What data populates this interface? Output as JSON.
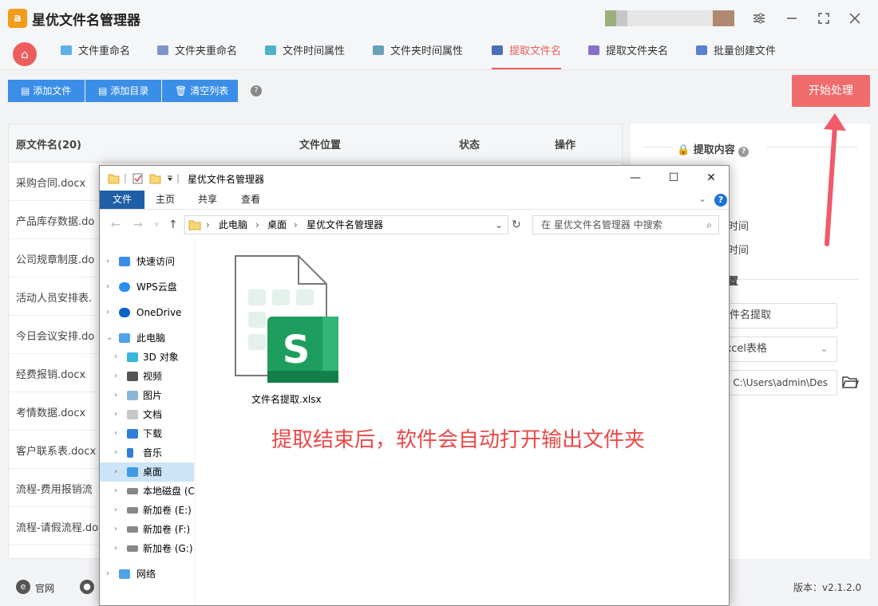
{
  "app": {
    "logo_glyph": "a",
    "title": "星优文件名管理器",
    "window_controls": [
      "settings-icon",
      "minimize-icon",
      "maximize-icon",
      "close-icon"
    ]
  },
  "nav": {
    "home_icon": "home-icon",
    "tabs": [
      {
        "label": "文件重命名",
        "active": false
      },
      {
        "label": "文件夹重命名",
        "active": false
      },
      {
        "label": "文件时间属性",
        "active": false
      },
      {
        "label": "文件夹时间属性",
        "active": false
      },
      {
        "label": "提取文件名",
        "active": true
      },
      {
        "label": "提取文件夹名",
        "active": false
      },
      {
        "label": "批量创建文件",
        "active": false
      }
    ]
  },
  "toolbar": {
    "add_file": "添加文件",
    "add_folder": "添加目录",
    "clear_list": "清空列表",
    "help": "?",
    "start": "开始处理"
  },
  "table": {
    "headers": {
      "name": "原文件名(20)",
      "location": "文件位置",
      "status": "状态",
      "action": "操作"
    },
    "rows": [
      "采购合同.docx",
      "产品库存数据.do",
      "公司规章制度.do",
      "活动人员安排表.",
      "今日会议安排.do",
      "经费报销.docx",
      "考情数据.docx",
      "客户联系表.docx",
      "流程-费用报销流",
      "流程-请假流程.do"
    ]
  },
  "right_panel": {
    "section_title": "提取内容",
    "partial_time_1": "时间",
    "partial_time_2": "时间",
    "partial_heading": "置",
    "mode_value": "文件名提取",
    "format_value": "excel表格",
    "output_path": "C:\\Users\\admin\\Des"
  },
  "footer": {
    "official_site": "官网",
    "version": "版本：v2.1.2.0"
  },
  "explorer": {
    "title": "星优文件名管理器",
    "ribbon_tabs": [
      {
        "label": "文件",
        "active": true
      },
      {
        "label": "主页",
        "active": false
      },
      {
        "label": "共享",
        "active": false
      },
      {
        "label": "查看",
        "active": false
      }
    ],
    "address": [
      "此电脑",
      "桌面",
      "星优文件名管理器"
    ],
    "search_placeholder": "在 星优文件名管理器 中搜索",
    "nav_items": [
      {
        "label": "快速访问",
        "icon": "star-icon",
        "indent": 0
      },
      {
        "label": "WPS云盘",
        "icon": "cloud-icon",
        "indent": 0
      },
      {
        "label": "OneDrive",
        "icon": "onedrive-icon",
        "indent": 0
      },
      {
        "label": "此电脑",
        "icon": "computer-icon",
        "indent": 0
      },
      {
        "label": "3D 对象",
        "icon": "cube-icon",
        "indent": 1
      },
      {
        "label": "视频",
        "icon": "video-icon",
        "indent": 1
      },
      {
        "label": "图片",
        "icon": "picture-icon",
        "indent": 1
      },
      {
        "label": "文档",
        "icon": "document-icon",
        "indent": 1
      },
      {
        "label": "下载",
        "icon": "download-icon",
        "indent": 1
      },
      {
        "label": "音乐",
        "icon": "music-icon",
        "indent": 1
      },
      {
        "label": "桌面",
        "icon": "desktop-icon",
        "indent": 1
      },
      {
        "label": "本地磁盘 (C",
        "icon": "drive-icon",
        "indent": 1
      },
      {
        "label": "新加卷 (E:)",
        "icon": "drive-icon",
        "indent": 1
      },
      {
        "label": "新加卷 (F:)",
        "icon": "drive-icon",
        "indent": 1
      },
      {
        "label": "新加卷 (G:)",
        "icon": "drive-icon",
        "indent": 1
      },
      {
        "label": "网络",
        "icon": "network-icon",
        "indent": 0
      }
    ],
    "selected_nav": "桌面",
    "file": {
      "name": "文件名提取.xlsx",
      "icon": "spreadsheet-file-icon",
      "badge": "S"
    }
  },
  "annotation": "提取结束后，软件会自动打开输出文件夹",
  "colors": {
    "accent": "#ee5d5d",
    "button_blue": "#3b8ee8",
    "start_button": "#ef6c6c",
    "annotation": "#ea4848",
    "sheet_green": "#1e9e5e"
  }
}
